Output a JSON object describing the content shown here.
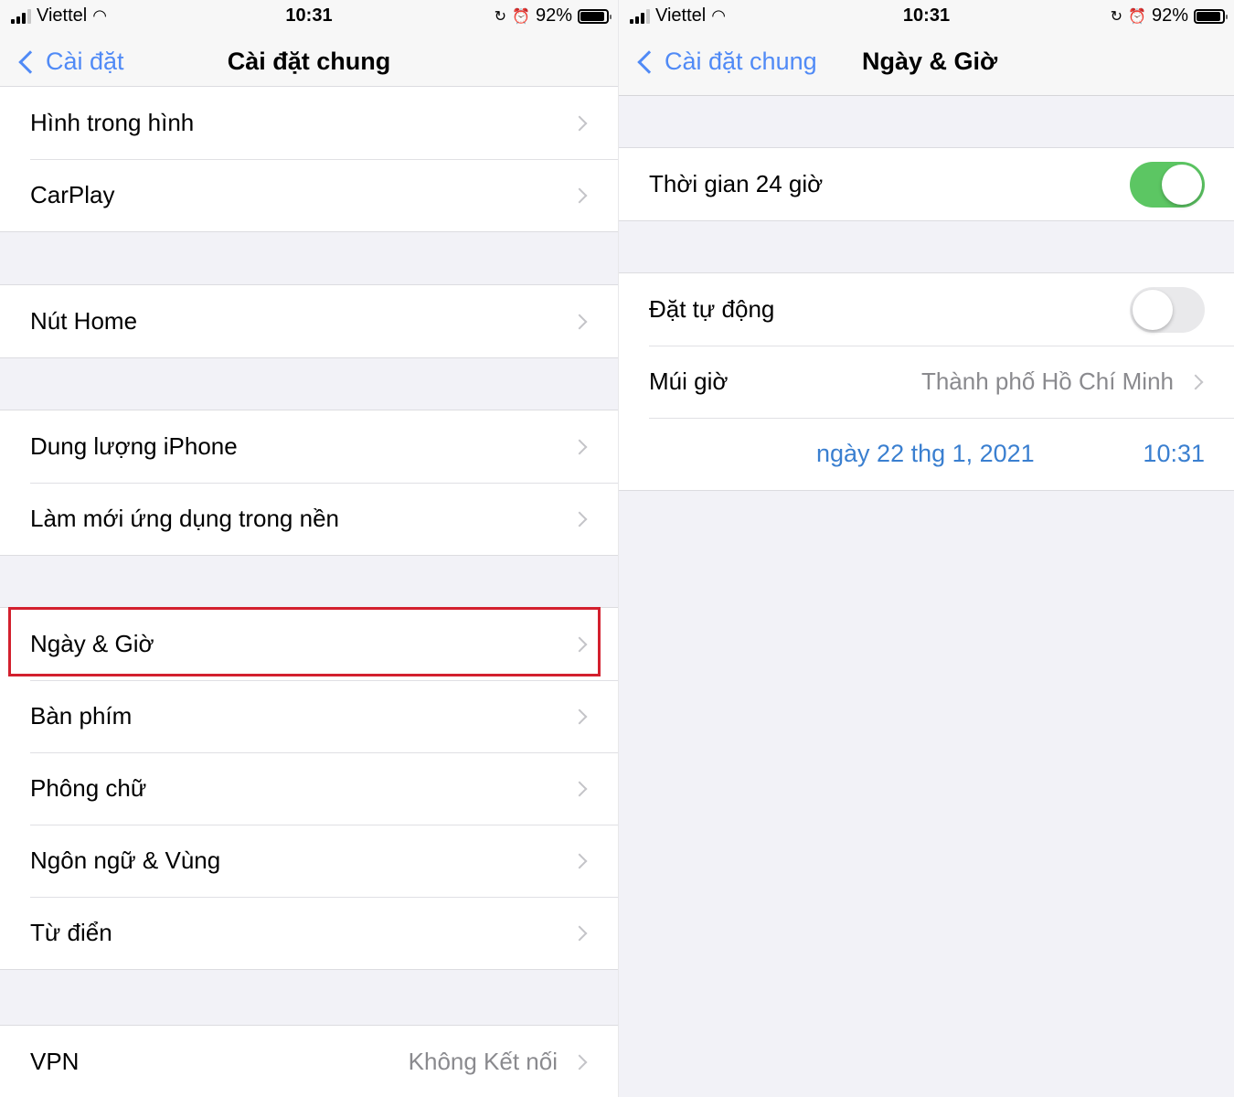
{
  "status_bar": {
    "carrier": "Viettel",
    "time": "10:31",
    "battery": "92%",
    "battery_level": 0.92
  },
  "left": {
    "back_label": "Cài đặt",
    "title": "Cài đặt chung",
    "groups": [
      {
        "items": [
          {
            "label": "Hình trong hình"
          },
          {
            "label": "CarPlay"
          }
        ]
      },
      {
        "items": [
          {
            "label": "Nút Home"
          }
        ]
      },
      {
        "items": [
          {
            "label": "Dung lượng iPhone"
          },
          {
            "label": "Làm mới ứng dụng trong nền"
          }
        ]
      },
      {
        "items": [
          {
            "label": "Ngày & Giờ",
            "highlighted": true
          },
          {
            "label": "Bàn phím"
          },
          {
            "label": "Phông chữ"
          },
          {
            "label": "Ngôn ngữ & Vùng"
          },
          {
            "label": "Từ điển"
          }
        ]
      },
      {
        "items": [
          {
            "label": "VPN",
            "value": "Không Kết nối"
          }
        ]
      }
    ]
  },
  "right": {
    "back_label": "Cài đặt chung",
    "title": "Ngày & Giờ",
    "time_24h": {
      "label": "Thời gian 24 giờ",
      "on": true
    },
    "auto_set": {
      "label": "Đặt tự động",
      "on": false
    },
    "timezone": {
      "label": "Múi giờ",
      "value": "Thành phố Hồ Chí Minh"
    },
    "date": "ngày 22 thg 1, 2021",
    "time": "10:31"
  },
  "colors": {
    "accent": "#3478f6",
    "toggle_on": "#5cc663",
    "highlight": "#d3202e"
  }
}
